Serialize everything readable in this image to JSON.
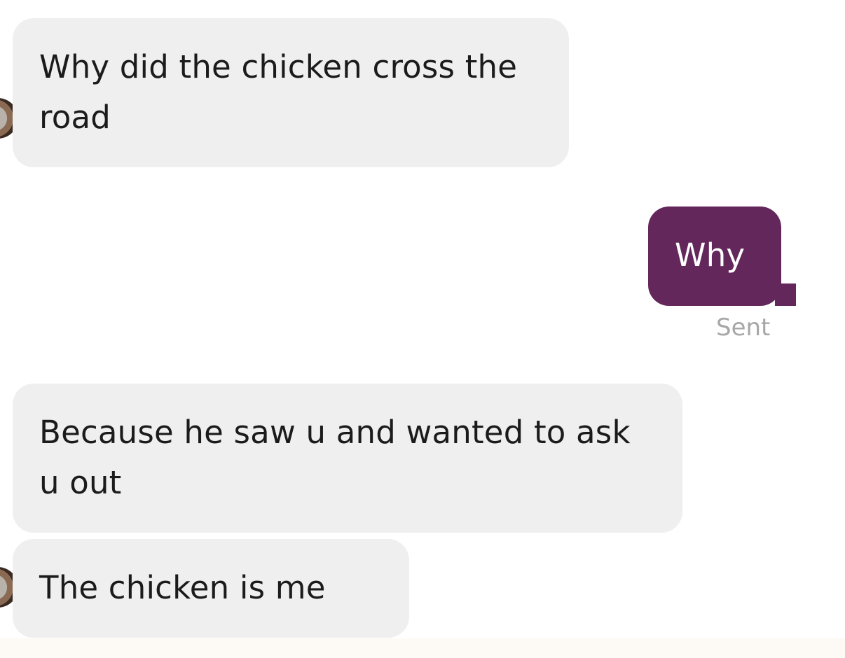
{
  "messages": [
    {
      "direction": "received",
      "text": "Why did the chicken cross the road"
    },
    {
      "direction": "sent",
      "text": "Why",
      "status": "Sent"
    },
    {
      "direction": "received",
      "text": "Because he saw u and wanted to ask u out"
    },
    {
      "direction": "received",
      "text": "The chicken is me"
    }
  ],
  "colors": {
    "received_bubble": "#efefef",
    "sent_bubble": "#64275c",
    "status_text": "#a7a7a7",
    "received_text": "#1b1b1b",
    "sent_text": "#ffffff"
  }
}
